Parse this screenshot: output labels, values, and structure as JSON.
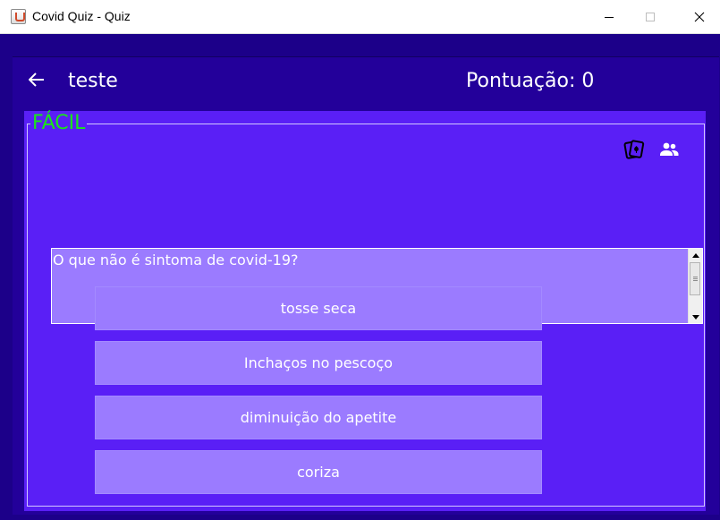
{
  "window": {
    "title": "Covid Quiz - Quiz",
    "app_icon": "java-cup-icon",
    "controls": [
      "minimize-icon",
      "maximize-icon",
      "close-icon"
    ]
  },
  "header": {
    "back_icon": "arrow-left-icon",
    "username": "teste",
    "score_label": "Pontuação: 0"
  },
  "quiz": {
    "difficulty": "FÁCIL",
    "tool_icons": [
      "cards-icon",
      "group-icon"
    ],
    "question": "O que não é sintoma de covid-19?",
    "answers": [
      "tosse seca",
      "Inchaços no pescoço",
      "diminuição do apetite",
      "coriza"
    ]
  },
  "colors": {
    "background": "#1c0089",
    "content": "#23009a",
    "panel": "#5a1ff6",
    "button": "#9b7bff",
    "difficulty": "#19e619",
    "text": "#ffffff"
  }
}
